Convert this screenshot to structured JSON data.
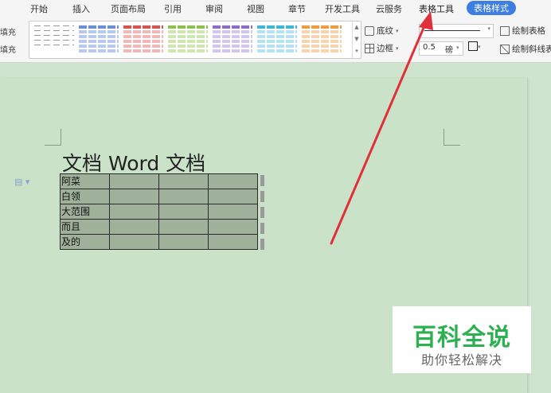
{
  "ribbon": {
    "tabs": [
      "开始",
      "插入",
      "页面布局",
      "引用",
      "审阅",
      "视图",
      "章节",
      "开发工具",
      "云服务",
      "表格工具",
      "表格样式"
    ],
    "left_fill_top": "填充",
    "left_fill_bottom": "填充",
    "shading_label": "底纹",
    "border_label": "边框",
    "point_value": "0.5",
    "point_unit": "磅",
    "draw_table_label": "绘制表格",
    "draw_diagonal_label": "绘制斜线表"
  },
  "styles": {
    "swatch_colors": [
      "#6b8fd6",
      "#d9534f",
      "#8cc14c",
      "#8e6cc9",
      "#3fb6d8",
      "#f19a3e"
    ]
  },
  "document": {
    "title": "文档 Word 文档",
    "rows": [
      "阿菜",
      "白领",
      "大范围",
      "而且",
      "及的"
    ]
  },
  "watermark": {
    "title": "百科全说",
    "subtitle": "助你轻松解决"
  }
}
